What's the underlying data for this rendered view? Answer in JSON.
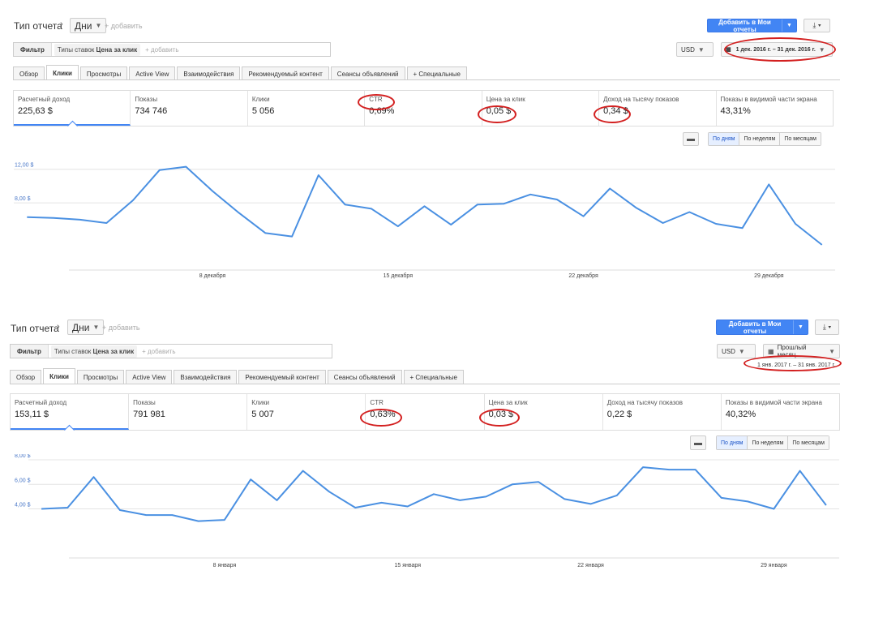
{
  "colors": {
    "accent": "#4285f4",
    "line": "#4a90e2",
    "annotation": "#d32020"
  },
  "reports": [
    {
      "report_type_label": "Тип отчета",
      "dimension": "Дни",
      "add_label": "+ добавить",
      "add_to_reports_button": "Добавить в Мои отчеты",
      "download_icon": "download-icon",
      "filter_label": "Фильтр",
      "filter_chip_prefix": "Типы ставок ",
      "filter_chip_value": "Цена за клик",
      "filter_add": "+ добавить",
      "currency": "USD",
      "date_range": "1 дек. 2016 г. – 31 дек. 2016 г.",
      "date_preset": "",
      "tabs": [
        "Обзор",
        "Клики",
        "Просмотры",
        "Active View",
        "Взаимодействия",
        "Рекомендуемый контент",
        "Сеансы объявлений",
        "+ Специальные"
      ],
      "active_tab": 1,
      "metrics": [
        {
          "label": "Расчетный доход",
          "value": "225,63 $"
        },
        {
          "label": "Показы",
          "value": "734 746"
        },
        {
          "label": "Клики",
          "value": "5 056"
        },
        {
          "label": "CTR",
          "value": "0,69%"
        },
        {
          "label": "Цена за клик",
          "value": "0,05 $"
        },
        {
          "label": "Доход на тысячу показов",
          "value": "0,34 $"
        },
        {
          "label": "Показы в видимой части экрана",
          "value": "43,31%"
        }
      ],
      "granularity": [
        "По дням",
        "По неделям",
        "По месяцам"
      ],
      "chart_data": {
        "type": "line",
        "y_tick_labels": [
          "12,00 $",
          "8,00 $"
        ],
        "y_ticks": [
          12,
          8
        ],
        "ylim": [
          0,
          14
        ],
        "x_tick_labels": [
          "8 декабря",
          "15 декабря",
          "22 декабря",
          "29 декабря"
        ],
        "x_ticks": [
          8,
          15,
          22,
          29
        ],
        "x": [
          1,
          2,
          3,
          4,
          5,
          6,
          7,
          8,
          9,
          10,
          11,
          12,
          13,
          14,
          15,
          16,
          17,
          18,
          19,
          20,
          21,
          22,
          23,
          24,
          25,
          26,
          27,
          28,
          29,
          30,
          31
        ],
        "values": [
          6.3,
          6.2,
          6.0,
          5.6,
          8.3,
          11.9,
          12.3,
          9.4,
          6.8,
          4.4,
          4.0,
          11.3,
          7.8,
          7.3,
          5.2,
          7.6,
          5.4,
          7.8,
          7.9,
          9.0,
          8.4,
          6.4,
          9.7,
          7.4,
          5.6,
          6.9,
          5.5,
          5.0,
          10.2,
          5.5,
          3.0
        ],
        "xlim": [
          0.5,
          31.5
        ]
      }
    },
    {
      "report_type_label": "Тип отчета",
      "dimension": "Дни",
      "add_label": "+ добавить",
      "add_to_reports_button": "Добавить в Мои отчеты",
      "download_icon": "download-icon",
      "filter_label": "Фильтр",
      "filter_chip_prefix": "Типы ставок ",
      "filter_chip_value": "Цена за клик",
      "filter_add": "+ добавить",
      "currency": "USD",
      "date_range": "1 янв. 2017 г. – 31 янв. 2017 г.",
      "date_preset": "Прошлый месяц",
      "tabs": [
        "Обзор",
        "Клики",
        "Просмотры",
        "Active View",
        "Взаимодействия",
        "Рекомендуемый контент",
        "Сеансы объявлений",
        "+ Специальные"
      ],
      "active_tab": 1,
      "metrics": [
        {
          "label": "Расчетный доход",
          "value": "153,11 $"
        },
        {
          "label": "Показы",
          "value": "791 981"
        },
        {
          "label": "Клики",
          "value": "5 007"
        },
        {
          "label": "CTR",
          "value": "0,63%"
        },
        {
          "label": "Цена за клик",
          "value": "0,03 $"
        },
        {
          "label": "Доход на тысячу показов",
          "value": "0,22 $"
        },
        {
          "label": "Показы в видимой части экрана",
          "value": "40,32%"
        }
      ],
      "granularity": [
        "По дням",
        "По неделям",
        "По месяцам"
      ],
      "chart_data": {
        "type": "line",
        "y_tick_labels": [
          "8,00 $",
          "6,00 $",
          "4,00 $"
        ],
        "y_ticks": [
          8,
          6,
          4
        ],
        "ylim": [
          0,
          8
        ],
        "x_tick_labels": [
          "8 января",
          "15 января",
          "22 января",
          "29 января"
        ],
        "x_ticks": [
          8,
          15,
          22,
          29
        ],
        "x": [
          1,
          2,
          3,
          4,
          5,
          6,
          7,
          8,
          9,
          10,
          11,
          12,
          13,
          14,
          15,
          16,
          17,
          18,
          19,
          20,
          21,
          22,
          23,
          24,
          25,
          26,
          27,
          28,
          29,
          30,
          31
        ],
        "values": [
          4.0,
          4.1,
          6.6,
          3.9,
          3.5,
          3.5,
          3.0,
          3.1,
          6.4,
          4.7,
          7.1,
          5.4,
          4.1,
          4.5,
          4.2,
          5.2,
          4.7,
          5.0,
          6.0,
          6.2,
          4.8,
          4.4,
          5.1,
          7.4,
          7.2,
          7.2,
          4.9,
          4.6,
          4.0,
          7.1,
          4.3
        ],
        "xlim": [
          0.5,
          31.5
        ]
      }
    }
  ]
}
